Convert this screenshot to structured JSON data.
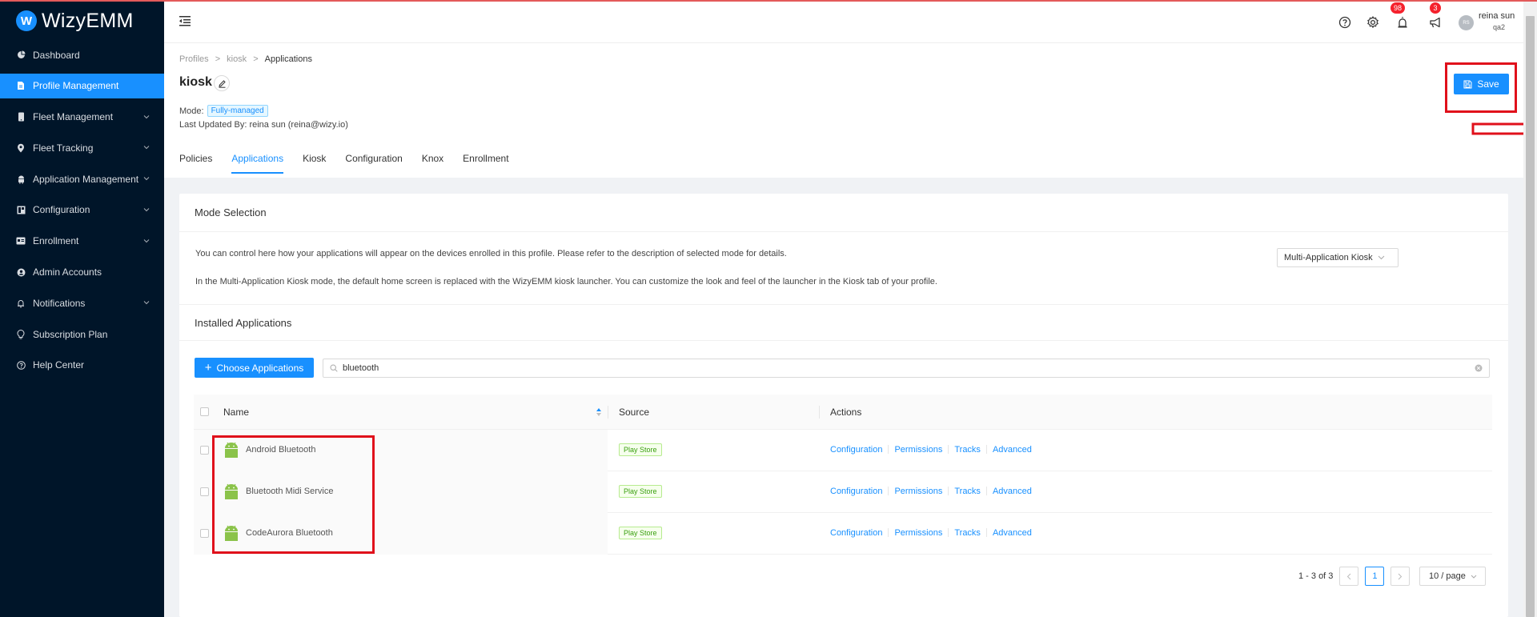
{
  "app": {
    "logo_text": "WizyEMM",
    "logo_mark": "W"
  },
  "sidebar": {
    "items": [
      {
        "label": "Dashboard",
        "icon": "pie-chart-icon",
        "active": false,
        "has_children": false
      },
      {
        "label": "Profile Management",
        "icon": "file-icon",
        "active": true,
        "has_children": false
      },
      {
        "label": "Fleet Management",
        "icon": "mobile-icon",
        "active": false,
        "has_children": true
      },
      {
        "label": "Fleet Tracking",
        "icon": "location-pin-icon",
        "active": false,
        "has_children": true
      },
      {
        "label": "Application Management",
        "icon": "android-icon",
        "active": false,
        "has_children": true
      },
      {
        "label": "Configuration",
        "icon": "layout-icon",
        "active": false,
        "has_children": true
      },
      {
        "label": "Enrollment",
        "icon": "id-card-icon",
        "active": false,
        "has_children": true
      },
      {
        "label": "Admin Accounts",
        "icon": "user-settings-icon",
        "active": false,
        "has_children": false
      },
      {
        "label": "Notifications",
        "icon": "bell-icon",
        "active": false,
        "has_children": true
      },
      {
        "label": "Subscription Plan",
        "icon": "bulb-icon",
        "active": false,
        "has_children": false
      },
      {
        "label": "Help Center",
        "icon": "question-circle-icon",
        "active": false,
        "has_children": false
      }
    ]
  },
  "topbar": {
    "alarm_badge": "98",
    "announce_badge": "3",
    "avatar_initials": "RS",
    "user_name": "reina sun",
    "user_org": "qa2"
  },
  "header": {
    "breadcrumb": [
      "Profiles",
      ">",
      "kiosk",
      ">",
      "Applications"
    ],
    "title": "kiosk",
    "mode_label": "Mode:",
    "mode_value": "Fully-managed",
    "last_updated": "Last Updated By: reina sun (reina@wizy.io)",
    "tabs": [
      {
        "label": "Policies",
        "active": false
      },
      {
        "label": "Applications",
        "active": true
      },
      {
        "label": "Kiosk",
        "active": false
      },
      {
        "label": "Configuration",
        "active": false
      },
      {
        "label": "Knox",
        "active": false
      },
      {
        "label": "Enrollment",
        "active": false
      }
    ],
    "save_label": "Save"
  },
  "mode_selection": {
    "title": "Mode Selection",
    "desc1": "You can control here how your applications will appear on the devices enrolled in this profile. Please refer to the description of selected mode for details.",
    "desc2": "In the Multi-Application Kiosk mode, the default home screen is replaced with the WizyEMM kiosk launcher. You can customize the look and feel of the launcher in the Kiosk tab of your profile.",
    "selected_mode": "Multi-Application Kiosk"
  },
  "installed": {
    "title": "Installed Applications",
    "choose_label": "Choose Applications",
    "search_value": "bluetooth",
    "columns": {
      "name": "Name",
      "source": "Source",
      "actions": "Actions"
    },
    "rows": [
      {
        "name": "Android Bluetooth",
        "source": "Play Store"
      },
      {
        "name": "Bluetooth Midi Service",
        "source": "Play Store"
      },
      {
        "name": "CodeAurora Bluetooth",
        "source": "Play Store"
      }
    ],
    "actions": [
      "Configuration",
      "Permissions",
      "Tracks",
      "Advanced"
    ]
  },
  "pagination": {
    "range": "1 - 3 of 3",
    "current_page": "1",
    "page_size": "10 / page"
  },
  "colors": {
    "primary": "#1890ff",
    "sidebar_bg": "#001529",
    "highlight_red": "#e0101b"
  }
}
